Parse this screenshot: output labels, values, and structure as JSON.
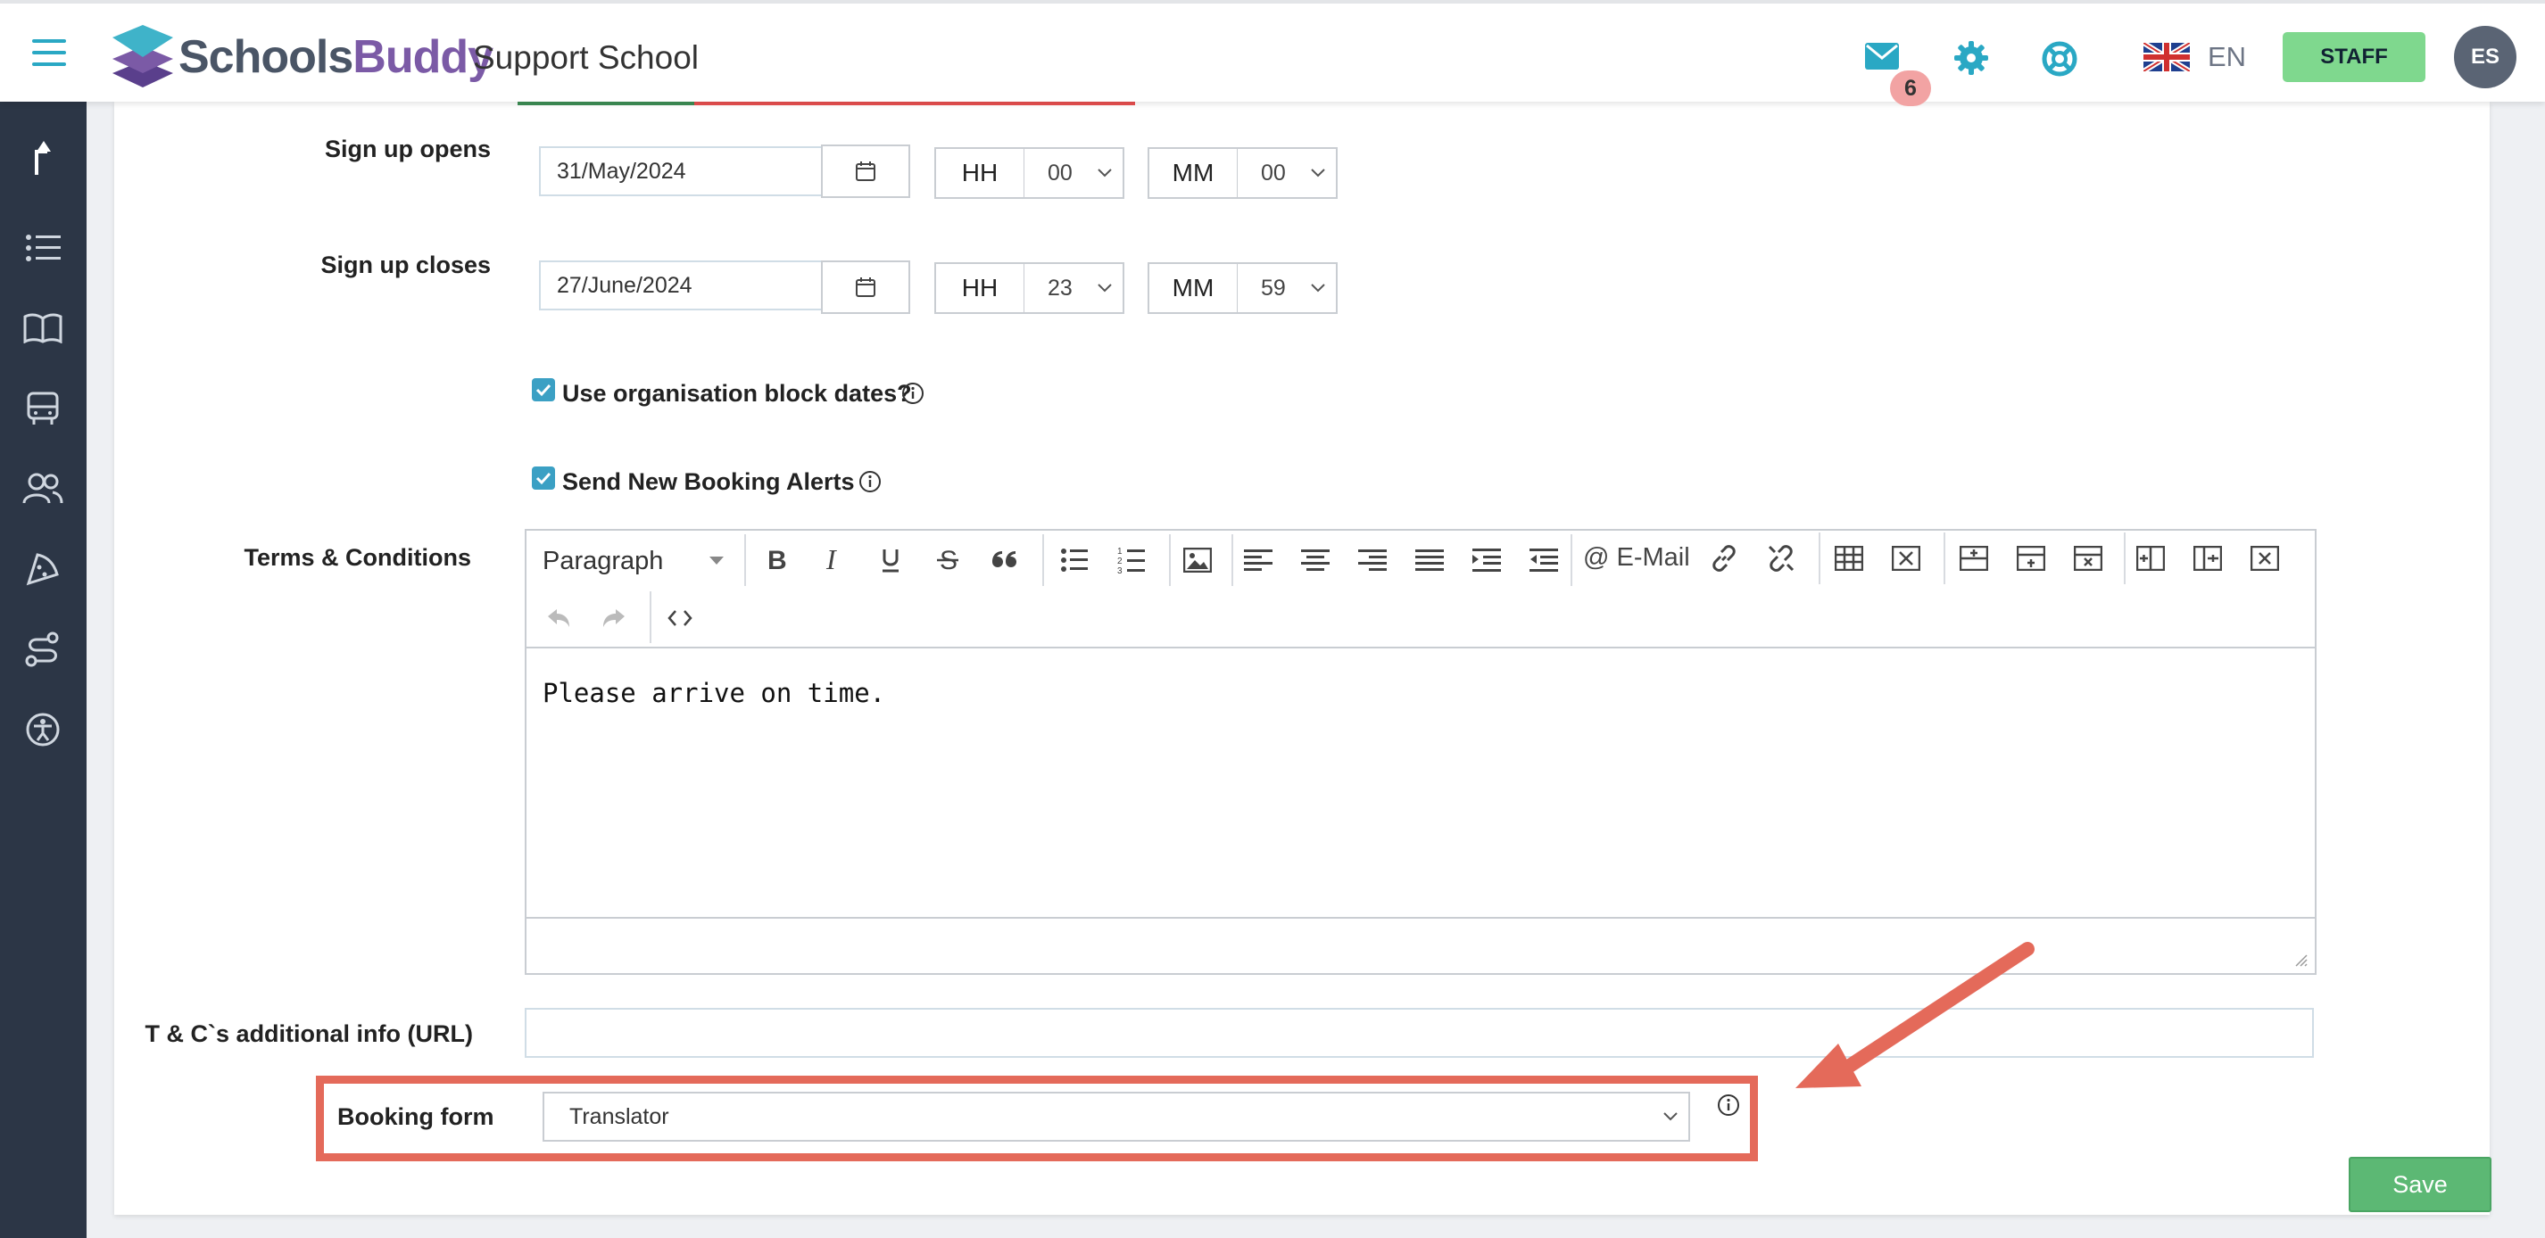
{
  "header": {
    "brand_part1": "Schools",
    "brand_part2": "Buddy",
    "school_name": "Support School",
    "mail_count": "6",
    "language": "EN",
    "staff_label": "STAFF",
    "avatar_initials": "ES"
  },
  "form": {
    "signup_opens": {
      "label": "Sign up opens",
      "date": "31/May/2024",
      "hh_label": "HH",
      "hh_value": "00",
      "mm_label": "MM",
      "mm_value": "00"
    },
    "signup_closes": {
      "label": "Sign up closes",
      "date": "27/June/2024",
      "hh_label": "HH",
      "hh_value": "23",
      "mm_label": "MM",
      "mm_value": "59"
    },
    "use_block_dates": {
      "label": "Use organisation block dates?",
      "checked": true
    },
    "send_alerts": {
      "label": "Send New Booking Alerts",
      "checked": true
    },
    "terms": {
      "label": "Terms & Conditions",
      "paragraph_style": "Paragraph",
      "email_button": "E-Mail",
      "content": "Please arrive on time."
    },
    "tc_url": {
      "label": "T & C`s additional info (URL)",
      "value": ""
    },
    "booking_form": {
      "label": "Booking form",
      "value": "Translator"
    },
    "save_label": "Save"
  },
  "colors": {
    "accent": "#2aa8c4",
    "sidebar": "#2c3646",
    "staff": "#7fd88e",
    "save": "#5cb874",
    "highlight": "#e46a5a"
  }
}
